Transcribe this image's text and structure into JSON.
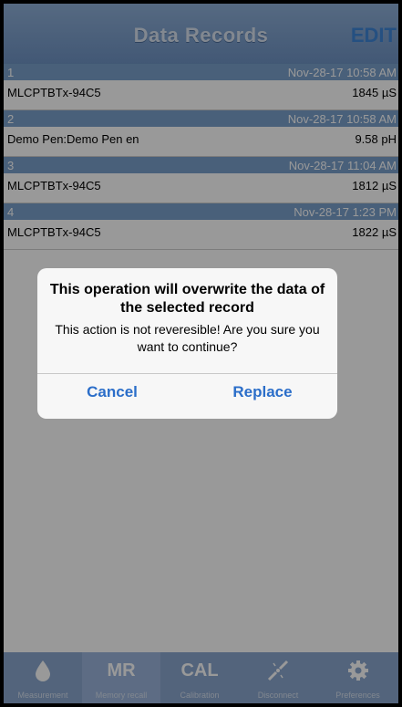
{
  "header": {
    "title": "Data Records",
    "edit_label": "EDIT"
  },
  "records": [
    {
      "index": "1",
      "timestamp": "Nov-28-17 10:58 AM",
      "device": "MLCPTBTx-94C5",
      "value": "1845 µS"
    },
    {
      "index": "2",
      "timestamp": "Nov-28-17 10:58 AM",
      "device": "Demo Pen:Demo Pen en",
      "value": "9.58 pH"
    },
    {
      "index": "3",
      "timestamp": "Nov-28-17 11:04 AM",
      "device": "MLCPTBTx-94C5",
      "value": "1812 µS"
    },
    {
      "index": "4",
      "timestamp": "Nov-28-17 1:23 PM",
      "device": "MLCPTBTx-94C5",
      "value": "1822 µS"
    }
  ],
  "dialog": {
    "title": "This operation will overwrite the data of the selected record",
    "message": "This action is not reveresible! Are you sure you want to continue?",
    "cancel_label": "Cancel",
    "replace_label": "Replace"
  },
  "tabbar": {
    "items": [
      {
        "icon": "droplet-icon",
        "label": "Measurement"
      },
      {
        "icon": "mr-icon",
        "label": "Memory recall",
        "icon_text": "MR"
      },
      {
        "icon": "cal-icon",
        "label": "Calibration",
        "icon_text": "CAL"
      },
      {
        "icon": "disconnect-icon",
        "label": "Disconnect"
      },
      {
        "icon": "gear-icon",
        "label": "Preferences"
      }
    ]
  },
  "colors": {
    "header": "#7aa0cc",
    "accent": "#2b6ec9",
    "edit": "#3f86d8"
  }
}
